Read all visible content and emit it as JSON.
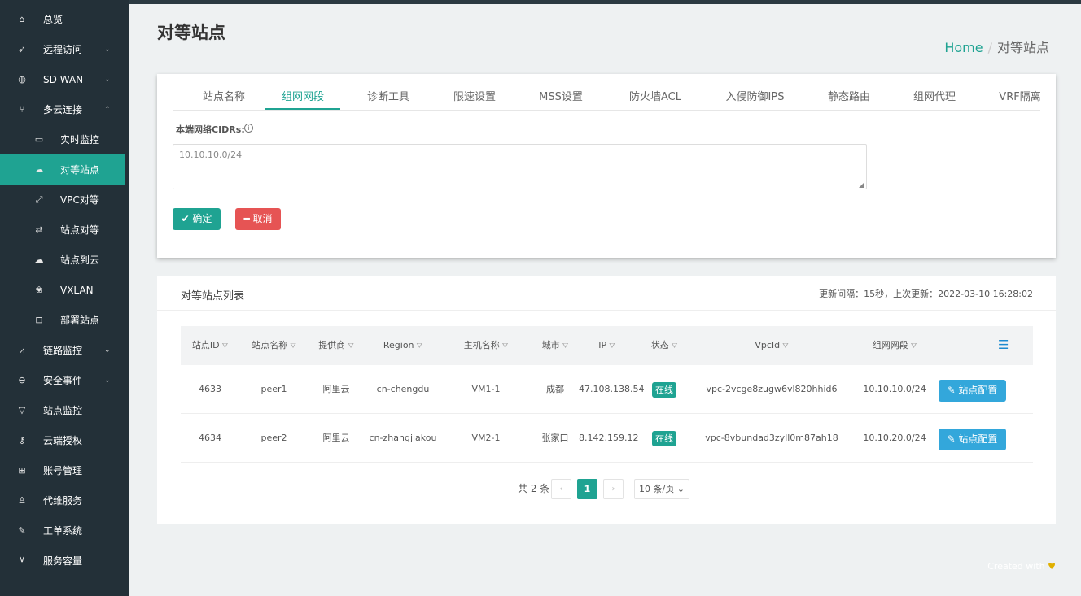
{
  "sidebar": {
    "items": [
      {
        "icon": "home-icon",
        "glyph": "⌂",
        "label": "总览",
        "chevron": ""
      },
      {
        "icon": "rocket-icon",
        "glyph": "➶",
        "label": "远程访问",
        "chevron": "⌄"
      },
      {
        "icon": "globe-icon",
        "glyph": "◍",
        "label": "SD-WAN",
        "chevron": "⌄"
      },
      {
        "icon": "fork-icon",
        "glyph": "⑂",
        "label": "多云连接",
        "chevron": "⌃"
      },
      {
        "icon": "monitor-icon",
        "glyph": "▭",
        "label": "实时监控",
        "chevron": ""
      },
      {
        "icon": "cloud-icon",
        "glyph": "☁",
        "label": "对等站点",
        "chevron": ""
      },
      {
        "icon": "expand-icon",
        "glyph": "⤢",
        "label": "VPC对等",
        "chevron": ""
      },
      {
        "icon": "sync-icon",
        "glyph": "⇄",
        "label": "站点对等",
        "chevron": ""
      },
      {
        "icon": "cloud-upload-icon",
        "glyph": "☁",
        "label": "站点到云",
        "chevron": ""
      },
      {
        "icon": "cluster-icon",
        "glyph": "❀",
        "label": "VXLAN",
        "chevron": ""
      },
      {
        "icon": "deploy-icon",
        "glyph": "⊟",
        "label": "部署站点",
        "chevron": ""
      },
      {
        "icon": "line-chart-icon",
        "glyph": "⩘",
        "label": "链路监控",
        "chevron": "⌄"
      },
      {
        "icon": "minus-circle-icon",
        "glyph": "⊖",
        "label": "安全事件",
        "chevron": "⌄"
      },
      {
        "icon": "filter-icon",
        "glyph": "▽",
        "label": "站点监控",
        "chevron": ""
      },
      {
        "icon": "key-icon",
        "glyph": "⚷",
        "label": "云端授权",
        "chevron": ""
      },
      {
        "icon": "users-icon",
        "glyph": "⊞",
        "label": "账号管理",
        "chevron": ""
      },
      {
        "icon": "user-icon",
        "glyph": "♙",
        "label": "代维服务",
        "chevron": ""
      },
      {
        "icon": "wrench-icon",
        "glyph": "✎",
        "label": "工单系统",
        "chevron": ""
      },
      {
        "icon": "cart-icon",
        "glyph": "⊻",
        "label": "服务容量",
        "chevron": ""
      }
    ],
    "active_label": "对等站点"
  },
  "header": {
    "title": "对等站点",
    "breadcrumb_home": "Home",
    "breadcrumb_sep": "/",
    "breadcrumb_current": "对等站点"
  },
  "tabs": {
    "items": [
      "站点名称",
      "组网网段",
      "诊断工具",
      "限速设置",
      "MSS设置",
      "防火墙ACL",
      "入侵防御IPS",
      "静态路由",
      "组网代理",
      "VRF隔离"
    ],
    "active": "组网网段"
  },
  "form": {
    "cidr_label": "本端网络CIDRs:",
    "info_glyph": "i",
    "cidr_value": "10.10.10.0/24",
    "confirm_label": "✔ 确定",
    "cancel_label": "━ 取消"
  },
  "list": {
    "title": "对等站点列表",
    "update_info": "更新间隔：15秒，上次更新：2022-03-10 16:28:02",
    "filter_glyph": "⛛",
    "columns": [
      "站点ID",
      "站点名称",
      "提供商",
      "Region",
      "主机名称",
      "城市",
      "IP",
      "状态",
      "VpcId",
      "组网网段"
    ],
    "settings_glyph": "☰",
    "rows": [
      {
        "id": "4633",
        "name": "peer1",
        "provider": "阿里云",
        "region": "cn-chengdu",
        "host": "VM1-1",
        "city": "成都",
        "ip": "47.108.138.54",
        "status": "在线",
        "vpcid": "vpc-2vcge8zugw6vl820hhid6",
        "cidr": "10.10.10.0/24",
        "action": "✎ 站点配置"
      },
      {
        "id": "4634",
        "name": "peer2",
        "provider": "阿里云",
        "region": "cn-zhangjiakou",
        "host": "VM2-1",
        "city": "张家口",
        "ip": "8.142.159.12",
        "status": "在线",
        "vpcid": "vpc-8vbundad3zyll0m87ah18",
        "cidr": "10.10.20.0/24",
        "action": "✎ 站点配置"
      }
    ]
  },
  "pagination": {
    "total_text": "共 2 条",
    "prev": "‹",
    "current_page": "1",
    "next": "›",
    "page_size": "10 条/页 ⌄"
  },
  "footer": {
    "text": "Created with",
    "heart": "♥"
  },
  "colors": {
    "accent": "#1fa392",
    "sidebar_bg": "#233038",
    "danger": "#e65454",
    "info": "#33a7db"
  }
}
